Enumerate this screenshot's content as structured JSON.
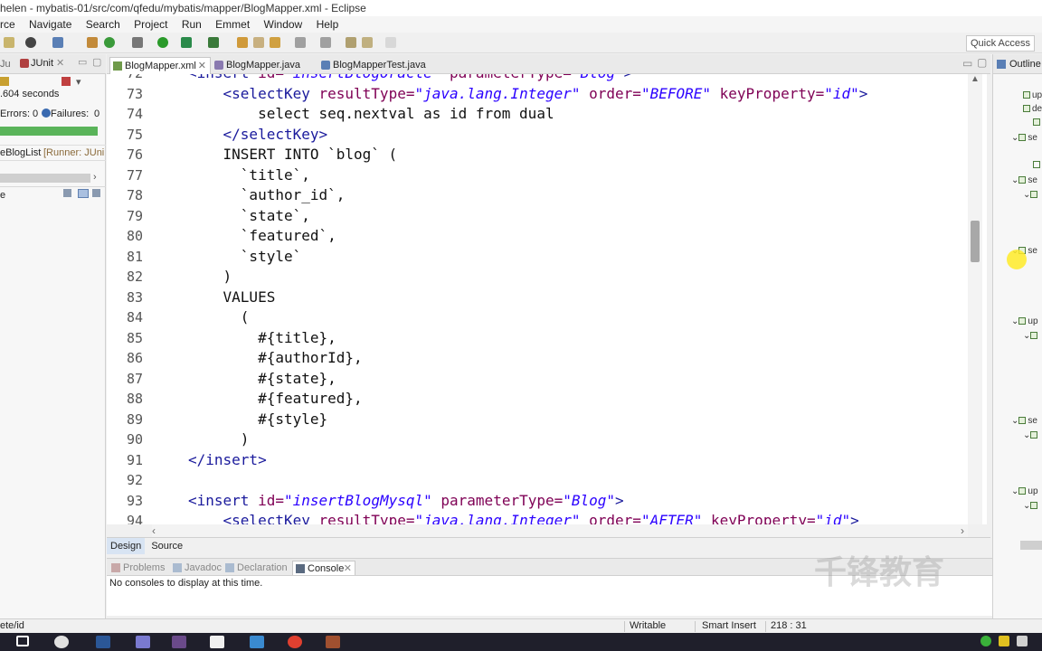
{
  "window": {
    "title": "helen - mybatis-01/src/com/qfedu/mybatis/mapper/BlogMapper.xml - Eclipse"
  },
  "menu": [
    "rce",
    "Navigate",
    "Search",
    "Project",
    "Run",
    "Emmet",
    "Window",
    "Help"
  ],
  "toolbar": {
    "quick_access": "Quick Access"
  },
  "junit": {
    "tab_label": "JUnit",
    "time": ".604 seconds",
    "errors_label": "Errors:",
    "errors": "0",
    "failures_label": "Failures:",
    "failures": "0",
    "test_entry": "eBlogList",
    "runner": "[Runner: JUni",
    "trace_label": "e"
  },
  "editor": {
    "tabs": [
      "BlogMapper.xml",
      "BlogMapper.java",
      "BlogMapperTest.java"
    ],
    "active_tab": "BlogMapper.xml",
    "lines": [
      {
        "n": "72",
        "html": "<span class='tag'>&lt;insert</span> <span class='attr'>id=</span><span class='str'>\"insertBlogOracle\"</span> <span class='attr'>parameterType=</span><span class='str'>\"Blog\"</span><span class='tag'>&gt;</span>"
      },
      {
        "n": "73",
        "html": "    <span class='tag'>&lt;selectKey</span> <span class='attr'>resultType=</span><span class='str'>\"java.lang.Integer\"</span> <span class='attr'>order=</span><span class='str'>\"BEFORE\"</span> <span class='attr'>keyProperty=</span><span class='str'>\"id\"</span><span class='tag'>&gt;</span>"
      },
      {
        "n": "74",
        "html": "        select seq.nextval as id from dual"
      },
      {
        "n": "75",
        "html": "    <span class='tag'>&lt;/selectKey&gt;</span>"
      },
      {
        "n": "76",
        "html": "    INSERT INTO `blog` ("
      },
      {
        "n": "77",
        "html": "      `title`,"
      },
      {
        "n": "78",
        "html": "      `author_id`,"
      },
      {
        "n": "79",
        "html": "      `state`,"
      },
      {
        "n": "80",
        "html": "      `featured`,"
      },
      {
        "n": "81",
        "html": "      `style`"
      },
      {
        "n": "82",
        "html": "    )"
      },
      {
        "n": "83",
        "html": "    VALUES"
      },
      {
        "n": "84",
        "html": "      ("
      },
      {
        "n": "85",
        "html": "        #{title},"
      },
      {
        "n": "86",
        "html": "        #{authorId},"
      },
      {
        "n": "87",
        "html": "        #{state},"
      },
      {
        "n": "88",
        "html": "        #{featured},"
      },
      {
        "n": "89",
        "html": "        #{style}"
      },
      {
        "n": "90",
        "html": "      )"
      },
      {
        "n": "91",
        "html": "<span class='tag'>&lt;/insert&gt;</span>"
      },
      {
        "n": "92",
        "html": ""
      },
      {
        "n": "93",
        "html": "<span class='tag'>&lt;insert</span> <span class='attr'>id=</span><span class='str'>\"insertBlogMysql\"</span> <span class='attr'>parameterType=</span><span class='str'>\"Blog\"</span><span class='tag'>&gt;</span>"
      },
      {
        "n": "94",
        "html": "    <span class='tag'>&lt;selectKey</span> <span class='attr'>resultType=</span><span class='str'>\"java.lang.Integer\"</span> <span class='attr'>order=</span><span class='str'>\"AFTER\"</span> <span class='attr'>keyProperty=</span><span class='str'>\"id\"</span><span class='tag'>&gt;</span>"
      }
    ]
  },
  "design_source": {
    "design": "Design",
    "source": "Source"
  },
  "console": {
    "tabs": [
      "Problems",
      "Javadoc",
      "Declaration",
      "Console"
    ],
    "active": "Console",
    "message": "No consoles to display at this time."
  },
  "outline": {
    "title": "Outline",
    "items": [
      "up",
      "de",
      "#",
      "se",
      "se",
      "se",
      "up",
      "se",
      "up"
    ]
  },
  "status": {
    "path": "ete/id",
    "writable": "Writable",
    "insert_mode": "Smart Insert",
    "position": "218 : 31"
  },
  "watermark": "千锋教育",
  "colors": {
    "junit_green": "#5ab45a",
    "tag": "#1a1a9c",
    "attribute": "#7f0055",
    "string": "#2a00ff"
  }
}
